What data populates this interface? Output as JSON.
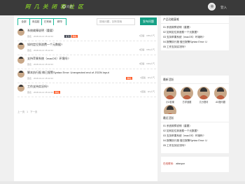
{
  "header": {
    "logo": "阿 几 关 闭 客 社 区",
    "help_label": "问题",
    "login_label": "登入"
  },
  "tabs": [
    {
      "label": "全部",
      "active": false
    },
    {
      "label": "未结贴",
      "active": false
    },
    {
      "label": "已采纳",
      "active": false
    },
    {
      "label": "精华",
      "active": false
    }
  ],
  "search": {
    "placeholder": "搜索问题，回车搜索"
  },
  "post_button": "发布问题",
  "questions": [
    {
      "title": "系统故障说明（重要）",
      "badges": [
        {
          "text": "置顶",
          "color": "dark"
        },
        {
          "text": "精帖",
          "color": "red"
        }
      ],
      "date": "2018-01-14 15:12:44",
      "answers": "1回答",
      "views": "0/55人气"
    },
    {
      "title": "如何定位到浪费一个元数据?",
      "badges": [],
      "date": "2018-01-14 15:12:44",
      "answers": "0回答",
      "views": "0/52人气"
    },
    {
      "title": "支持苹果系统（macOS）环境吗?",
      "badges": [],
      "date": "2018-01-14 15:12:44",
      "answers": "0回答",
      "views": "0/49人气"
    },
    {
      "title": "脚本执行报 做已报警Syntax Error: Unexpected end of JSON input",
      "badges": [
        {
          "text": "精帖",
          "color": "red"
        }
      ],
      "date": "2018-01-14 15:12:44",
      "answers": "0回答",
      "views": "0/1人气"
    },
    {
      "title": "工作支持实况吗?",
      "badges": [
        {
          "text": "精帖",
          "color": "red"
        }
      ],
      "date": "2018-01-14 15:12:44",
      "answers": "0回答",
      "views": "0/1人气"
    }
  ],
  "anon_label": "匿名",
  "pager": {
    "prev": "上一页",
    "page": "1",
    "next": "下一页"
  },
  "sidebar": {
    "hot_title": "产品功能疑难",
    "hot_items": [
      "01 系统故障说明（重要）",
      "02 如何定位到浪费一个元数据?",
      "03 支持苹果系统（macOS）环境吗?",
      "04 报警执行报 做已报警Syntax Error: U",
      "05 工作支持实况吗?"
    ],
    "people_title": "最新活跃",
    "people": [
      {
        "name": "小D答案"
      },
      {
        "name": "方洋选题"
      },
      {
        "name": "几分提问"
      },
      {
        "name": "AX提问题"
      },
      {
        "name": "正方提问"
      }
    ],
    "recent_title": "最近活跃",
    "recent_items": [
      "01 系统故障说明（重要）",
      "02 如何定位到浪费一个元数据?",
      "03 支持苹果系统（macOS）环境吗?",
      "04 报警执行报 做已报警Syntax Error: U",
      "05 工作支持实况吗?"
    ],
    "contact_label": "在线联系:",
    "contact_value": "afanyun"
  }
}
